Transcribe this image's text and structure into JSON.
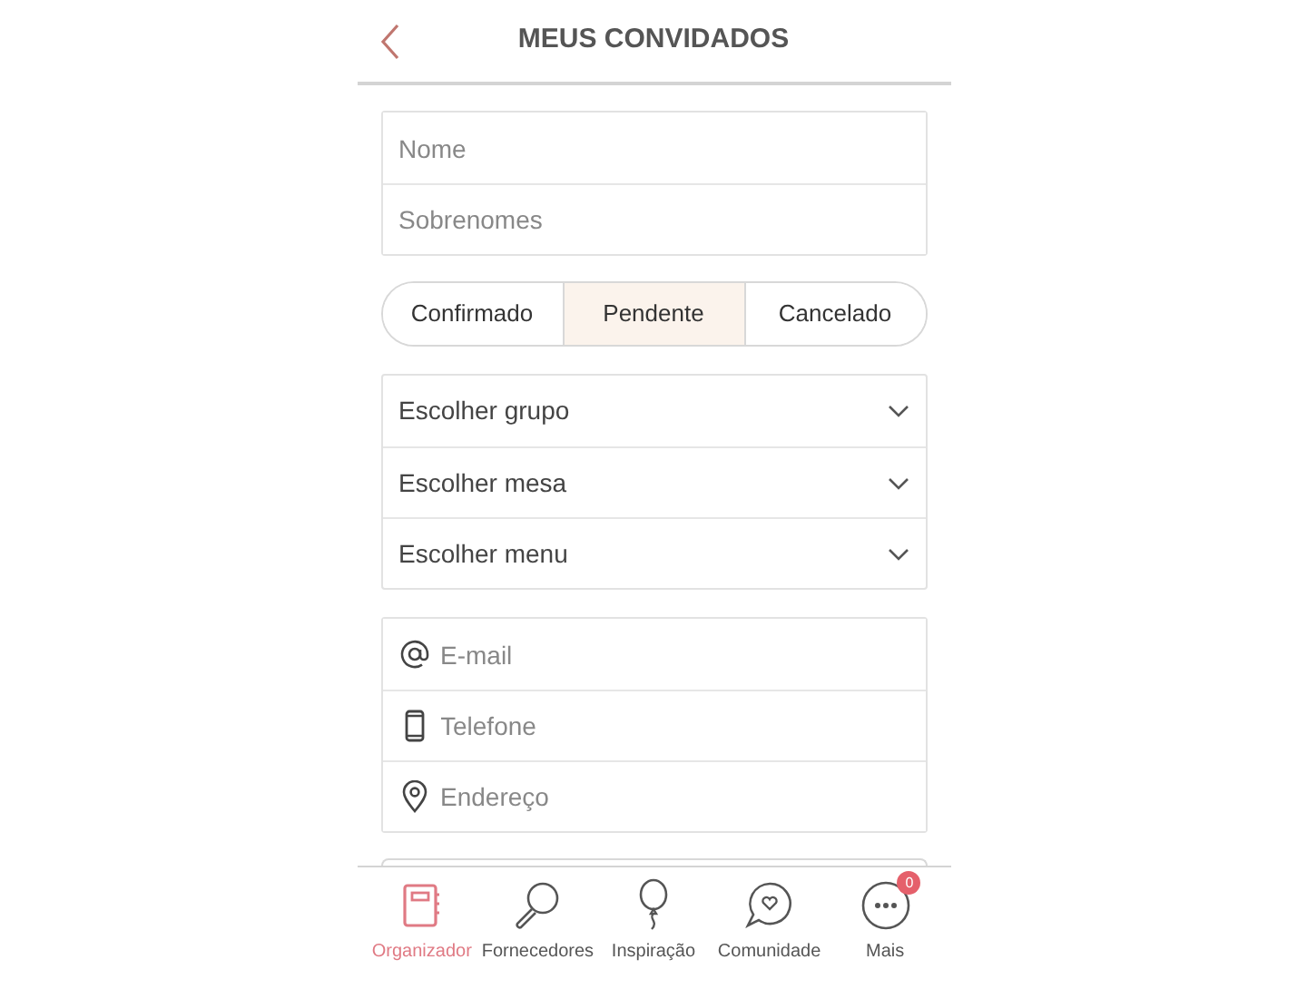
{
  "header": {
    "title": "MEUS CONVIDADOS"
  },
  "name_fields": [
    {
      "placeholder": "Nome"
    },
    {
      "placeholder": "Sobrenomes"
    }
  ],
  "status_tabs": [
    {
      "label": "Confirmado",
      "selected": false
    },
    {
      "label": "Pendente",
      "selected": true
    },
    {
      "label": "Cancelado",
      "selected": false
    }
  ],
  "selects": [
    {
      "label": "Escolher grupo"
    },
    {
      "label": "Escolher mesa"
    },
    {
      "label": "Escolher menu"
    }
  ],
  "contact_fields": [
    {
      "kind": "email",
      "placeholder": "E-mail"
    },
    {
      "kind": "phone",
      "placeholder": "Telefone"
    },
    {
      "kind": "address",
      "placeholder": "Endereço"
    }
  ],
  "tab_bar": [
    {
      "kind": "organizer",
      "label": "Organizador",
      "selected": true
    },
    {
      "kind": "vendors",
      "label": "Fornecedores",
      "selected": false
    },
    {
      "kind": "inspiration",
      "label": "Inspiração",
      "selected": false
    },
    {
      "kind": "community",
      "label": "Comunidade",
      "selected": false
    },
    {
      "kind": "more",
      "label": "Mais",
      "selected": false,
      "badge": "0"
    }
  ]
}
